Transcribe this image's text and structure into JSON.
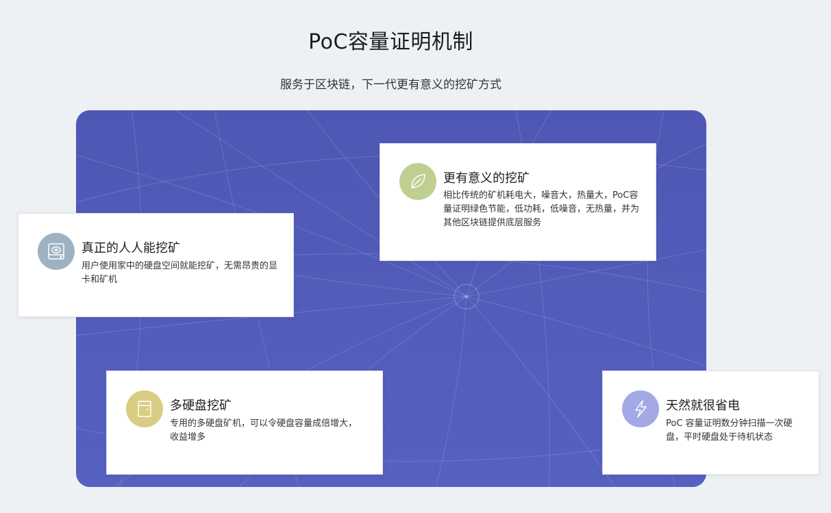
{
  "header": {
    "title": "PoC容量证明机制",
    "subtitle": "服务于区块链，下一代更有意义的挖矿方式"
  },
  "colors": {
    "page_background": "#eef1f4",
    "panel_background": "#525cb9",
    "icon_drive": "#9db3c3",
    "icon_leaf": "#bfcf92",
    "icon_disk": "#d8cd82",
    "icon_bolt": "#a3a9e5"
  },
  "features": [
    {
      "icon": "hard-drive-icon",
      "title": "真正的人人能挖矿",
      "description": "用户使用家中的硬盘空间就能挖矿，无需昂贵的显卡和矿机"
    },
    {
      "icon": "leaf-icon",
      "title": "更有意义的挖矿",
      "description": "相比传统的矿机耗电大，噪音大，热量大，PoC容量证明绿色节能，低功耗，低噪音，无热量，并为其他区块链提供底层服务"
    },
    {
      "icon": "disk-box-icon",
      "title": "多硬盘挖矿",
      "description": "专用的多硬盘矿机，可以令硬盘容量成倍增大，收益增多"
    },
    {
      "icon": "lightning-icon",
      "title": "天然就很省电",
      "description": "PoC 容量证明数分钟扫描一次硬盘，平时硬盘处于待机状态"
    }
  ]
}
